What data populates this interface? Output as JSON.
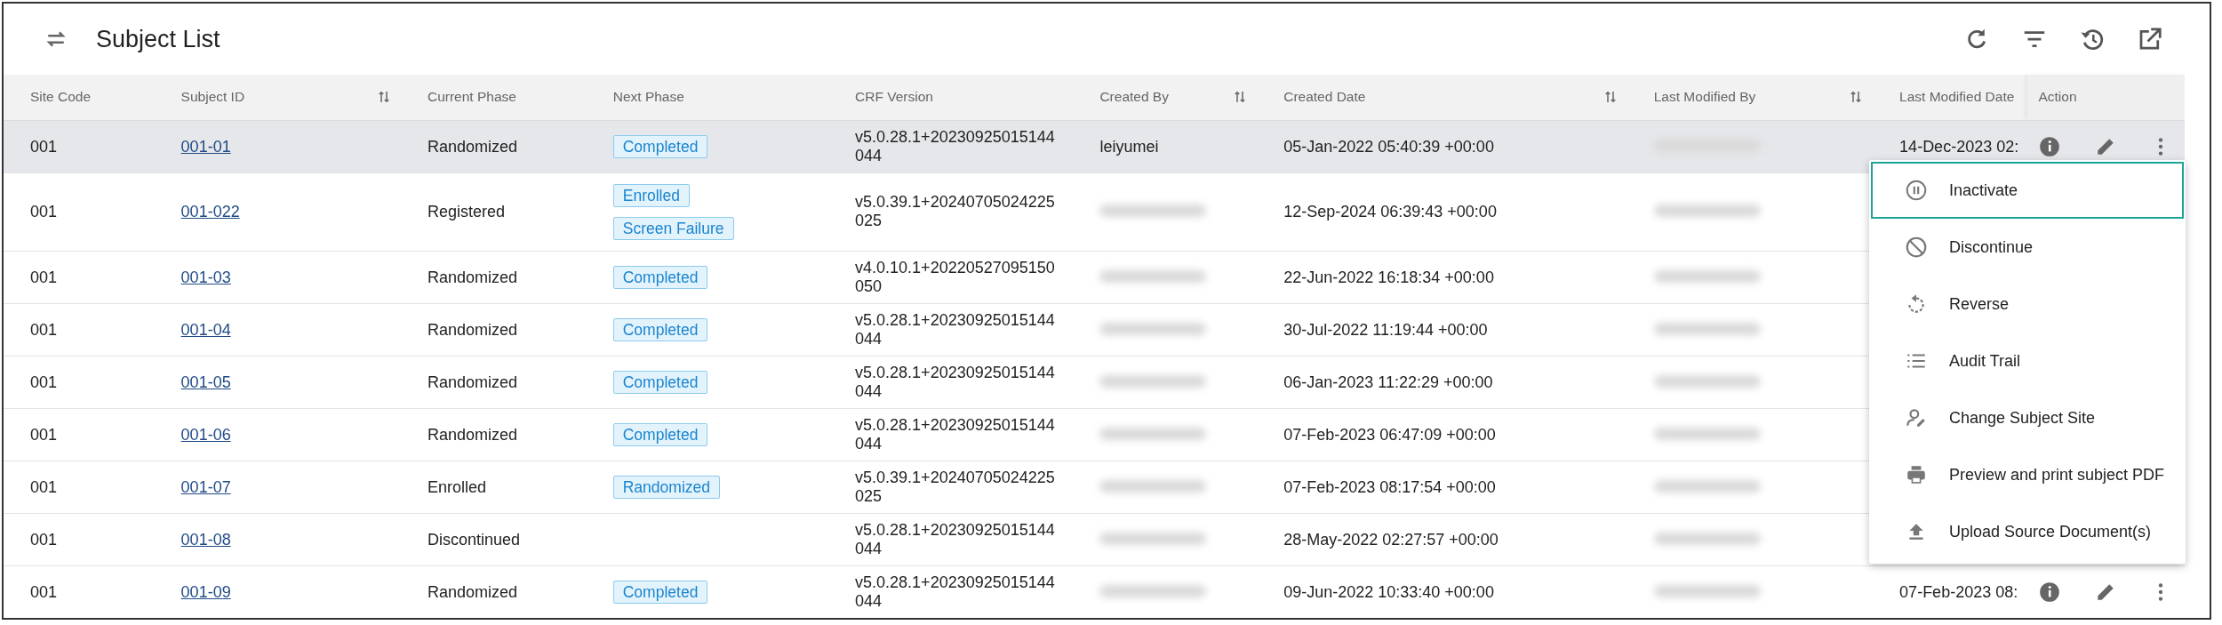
{
  "header": {
    "title": "Subject List"
  },
  "columns": [
    {
      "label": "Site Code",
      "sortable": false
    },
    {
      "label": "Subject ID",
      "sortable": true
    },
    {
      "label": "Current Phase",
      "sortable": false
    },
    {
      "label": "Next Phase",
      "sortable": false
    },
    {
      "label": "CRF Version",
      "sortable": false
    },
    {
      "label": "Created By",
      "sortable": true
    },
    {
      "label": "Created Date",
      "sortable": true
    },
    {
      "label": "Last Modified By",
      "sortable": true
    },
    {
      "label": "Last Modified Date",
      "sortable": false
    },
    {
      "label": "Action",
      "sortable": false
    }
  ],
  "rows": [
    {
      "selected": true,
      "site_code": "001",
      "subject_id": "001-01",
      "current_phase": "Randomized",
      "next_phase": [
        "Completed"
      ],
      "crf_version": "v5.0.28.1+20230925015144044",
      "created_by": {
        "kind": "text",
        "text": "leiyumei"
      },
      "created_date": "05-Jan-2022 05:40:39 +00:00",
      "last_modified_by": {
        "kind": "redacted"
      },
      "last_modified_date": "14-Dec-2023 02:",
      "actions": [
        {
          "kind": "info"
        },
        {
          "kind": "edit"
        },
        {
          "kind": "more"
        }
      ]
    },
    {
      "selected": false,
      "site_code": "001",
      "subject_id": "001-022",
      "current_phase": "Registered",
      "next_phase": [
        "Enrolled",
        "Screen Failure"
      ],
      "crf_version": "v5.0.39.1+20240705024225025",
      "created_by": {
        "kind": "redacted"
      },
      "created_date": "12-Sep-2024 06:39:43 +00:00",
      "last_modified_by": {
        "kind": "redacted"
      }
    },
    {
      "selected": false,
      "site_code": "001",
      "subject_id": "001-03",
      "current_phase": "Randomized",
      "next_phase": [
        "Completed"
      ],
      "crf_version": "v4.0.10.1+20220527095150050",
      "created_by": {
        "kind": "redacted"
      },
      "created_date": "22-Jun-2022 16:18:34 +00:00",
      "last_modified_by": {
        "kind": "redacted"
      }
    },
    {
      "selected": false,
      "site_code": "001",
      "subject_id": "001-04",
      "current_phase": "Randomized",
      "next_phase": [
        "Completed"
      ],
      "crf_version": "v5.0.28.1+20230925015144044",
      "created_by": {
        "kind": "redacted"
      },
      "created_date": "30-Jul-2022 11:19:44 +00:00",
      "last_modified_by": {
        "kind": "redacted"
      }
    },
    {
      "selected": false,
      "site_code": "001",
      "subject_id": "001-05",
      "current_phase": "Randomized",
      "next_phase": [
        "Completed"
      ],
      "crf_version": "v5.0.28.1+20230925015144044",
      "created_by": {
        "kind": "redacted"
      },
      "created_date": "06-Jan-2023 11:22:29 +00:00",
      "last_modified_by": {
        "kind": "redacted"
      }
    },
    {
      "selected": false,
      "site_code": "001",
      "subject_id": "001-06",
      "current_phase": "Randomized",
      "next_phase": [
        "Completed"
      ],
      "crf_version": "v5.0.28.1+20230925015144044",
      "created_by": {
        "kind": "redacted"
      },
      "created_date": "07-Feb-2023 06:47:09 +00:00",
      "last_modified_by": {
        "kind": "redacted"
      }
    },
    {
      "selected": false,
      "site_code": "001",
      "subject_id": "001-07",
      "current_phase": "Enrolled",
      "next_phase": [
        "Randomized"
      ],
      "crf_version": "v5.0.39.1+20240705024225025",
      "created_by": {
        "kind": "redacted"
      },
      "created_date": "07-Feb-2023 08:17:54 +00:00",
      "last_modified_by": {
        "kind": "redacted"
      }
    },
    {
      "selected": false,
      "site_code": "001",
      "subject_id": "001-08",
      "current_phase": "Discontinued",
      "crf_version": "v5.0.28.1+20230925015144044",
      "created_by": {
        "kind": "redacted"
      },
      "created_date": "28-May-2022 02:27:57 +00:00",
      "last_modified_by": {
        "kind": "redacted"
      }
    },
    {
      "selected": false,
      "site_code": "001",
      "subject_id": "001-09",
      "current_phase": "Randomized",
      "next_phase": [
        "Completed"
      ],
      "crf_version": "v5.0.28.1+20230925015144044",
      "created_by": {
        "kind": "redacted"
      },
      "created_date": "09-Jun-2022 10:33:40 +00:00",
      "last_modified_by": {
        "kind": "redacted"
      },
      "last_modified_date": "07-Feb-2023 08:",
      "actions": [
        {
          "kind": "info"
        },
        {
          "kind": "edit"
        },
        {
          "kind": "more"
        }
      ]
    }
  ],
  "action_menu": [
    {
      "kind": "pause",
      "label": "Inactivate",
      "selected": true
    },
    {
      "kind": "block",
      "label": "Discontinue",
      "selected": false
    },
    {
      "kind": "reverse",
      "label": "Reverse",
      "selected": false
    },
    {
      "kind": "list",
      "label": "Audit Trail",
      "selected": false
    },
    {
      "kind": "person-edit",
      "label": "Change Subject Site",
      "selected": false
    },
    {
      "kind": "print",
      "label": "Preview and print subject PDF",
      "selected": false
    },
    {
      "kind": "upload",
      "label": "Upload Source Document(s)",
      "selected": false
    }
  ]
}
